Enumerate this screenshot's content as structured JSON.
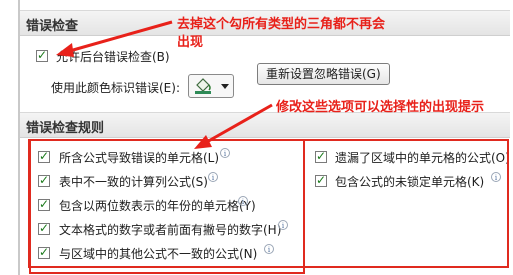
{
  "colors": {
    "annotation": "#e8211a",
    "checkbox_tick": "#1b7a1b"
  },
  "error_checking": {
    "title": "错误检查",
    "enable_background": {
      "label": "允许后台错误检查(B)",
      "checked": true
    },
    "color_label": "使用此颜色标识错误(E):",
    "color_picker_icon": "paint-bucket-icon",
    "reset_button": "重新设置忽略错误(G)"
  },
  "rules": {
    "title": "错误检查规则",
    "items": [
      {
        "label": "所含公式导致错误的单元格(L)",
        "checked": true
      },
      {
        "label": "表中不一致的计算列公式(S)",
        "checked": true
      },
      {
        "label": "包含以两位数表示的年份的单元格(Y)",
        "checked": true
      },
      {
        "label": "文本格式的数字或者前面有撇号的数字(H)",
        "checked": true
      },
      {
        "label": "与区域中的其他公式不一致的公式(N)",
        "checked": true
      },
      {
        "label": "遗漏了区域中的单元格的公式(O)",
        "checked": true
      },
      {
        "label": "包含公式的未锁定单元格(K)",
        "checked": true
      }
    ]
  },
  "annotations": {
    "top_line1": "去掉这个勾所有类型的三角都不再会",
    "top_line2": "出现",
    "middle": "修改这些选项可以选择性的出现提示"
  }
}
